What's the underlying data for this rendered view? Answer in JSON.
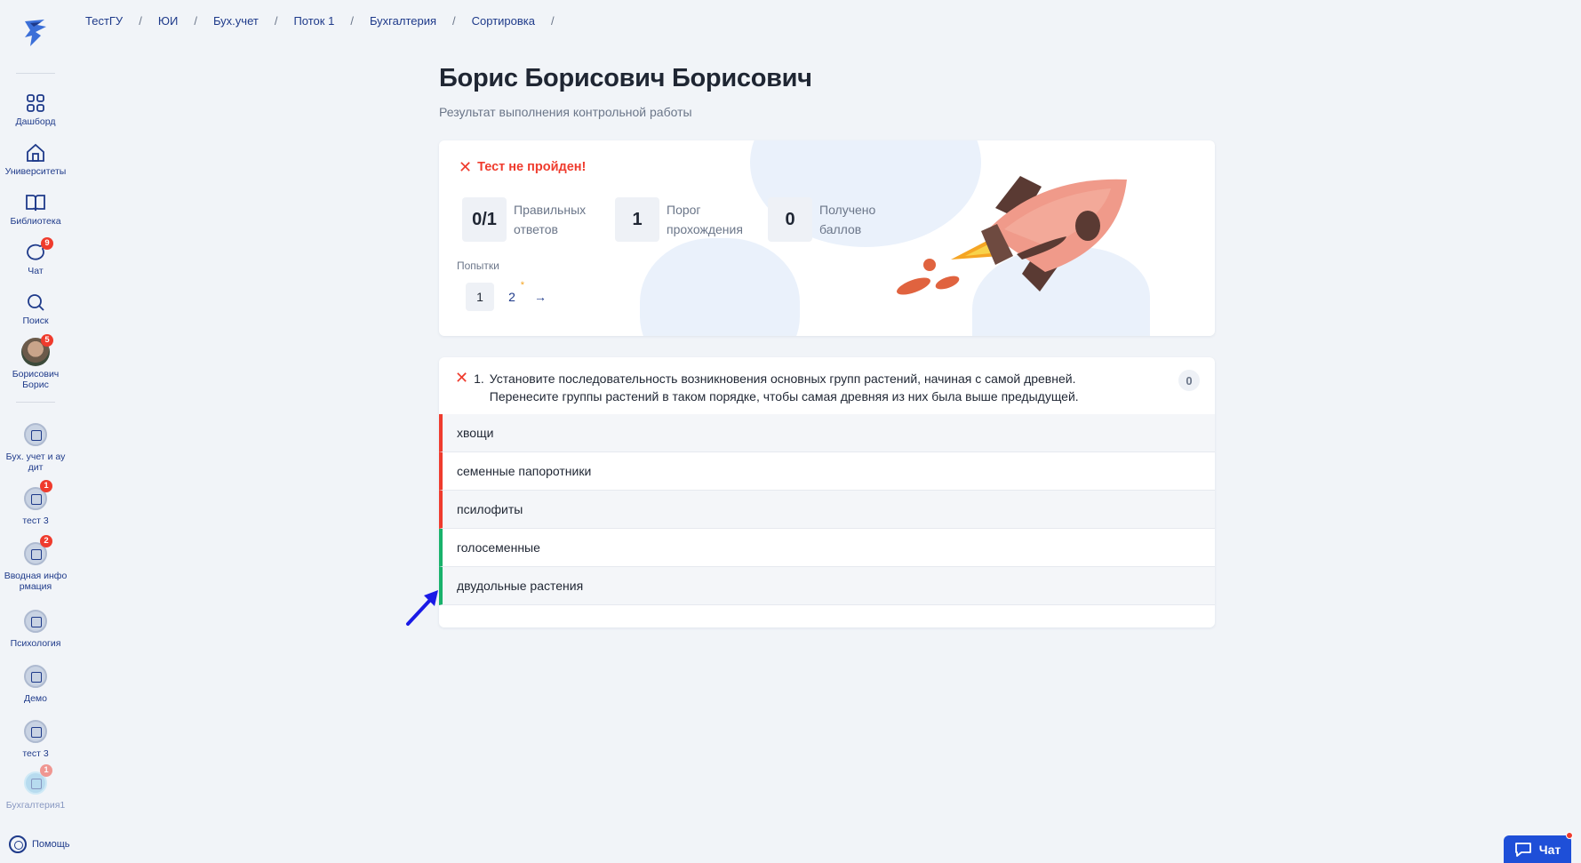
{
  "colors": {
    "accent": "#1e3a8a",
    "error": "#ef3b2d",
    "success": "#18b26b",
    "chat": "#1e4fd8"
  },
  "breadcrumb": [
    "ТестГУ",
    "ЮИ",
    "Бух.учет",
    "Поток 1",
    "Бухгалтерия",
    "Сортировка"
  ],
  "breadcrumb_separator": "/",
  "sidebar": {
    "nav": [
      {
        "label": "Дашборд",
        "icon": "grid-icon"
      },
      {
        "label": "Университеты",
        "icon": "home-icon"
      },
      {
        "label": "Библиотека",
        "icon": "book-icon"
      },
      {
        "label": "Чат",
        "icon": "chat-icon",
        "badge": "9"
      },
      {
        "label": "Поиск",
        "icon": "search-icon"
      }
    ],
    "profile": {
      "name": "Борисович Борис",
      "badge": "5"
    },
    "courses": [
      {
        "label": "Бух. учет и ау дит"
      },
      {
        "label": "тест 3",
        "badge": "1"
      },
      {
        "label": "Вводная инфо рмация",
        "badge": "2"
      },
      {
        "label": "Психология"
      },
      {
        "label": "Демо"
      },
      {
        "label": "тест 3"
      },
      {
        "label": "Бухгалтерия1",
        "badge": "1"
      }
    ],
    "help": "Помощь"
  },
  "page": {
    "title": "Борис Борисович Борисович",
    "subtitle": "Результат выполнения контрольной работы"
  },
  "result": {
    "status": "Тест не пройден!",
    "stats": [
      {
        "value": "0/1",
        "label": "Правильных ответов"
      },
      {
        "value": "1",
        "label": "Порог прохождения"
      },
      {
        "value": "0",
        "label": "Получено баллов"
      }
    ],
    "attempts_label": "Попытки",
    "attempts": [
      "1",
      "2"
    ],
    "attempt_star": "*",
    "next_arrow": "→"
  },
  "question": {
    "number": "1.",
    "text": "Установите последовательность возникновения основных групп растений, начиная с самой древней. Перенесите группы растений в таком порядке, чтобы самая древняя из них была выше предыдущей.",
    "score": "0",
    "answers": [
      {
        "text": "хвощи",
        "status": "wrong"
      },
      {
        "text": "семенные папоротники",
        "status": "wrong"
      },
      {
        "text": "псилофиты",
        "status": "wrong"
      },
      {
        "text": "голосеменные",
        "status": "right"
      },
      {
        "text": "двудольные растения",
        "status": "right"
      }
    ]
  },
  "chat_button": {
    "label": "Чат"
  }
}
